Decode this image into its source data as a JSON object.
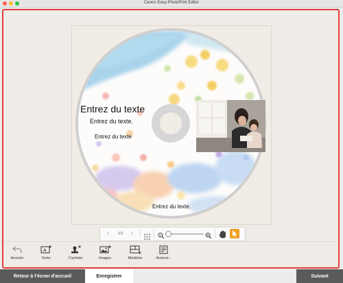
{
  "window": {
    "title": "Canon Easy-PhotoPrint Editor"
  },
  "disc": {
    "text1": "Entrez du texte",
    "text2": "Entrez du texte.",
    "text3": "Entrez du texte",
    "text4": "Entrez du texte."
  },
  "zoom_bar": {
    "page_indicator": "1/1"
  },
  "tools": {
    "undo": "Annuler",
    "text": "Texte",
    "stamps": "Cachets",
    "images": "Images",
    "templates": "Modèles",
    "advanced": "Avancé..."
  },
  "footer": {
    "back_home": "Retour à l'écran d'accueil",
    "save": "Enregistrer",
    "next": "Suivant"
  },
  "colors": {
    "accent_red": "#e53b3b",
    "dark_button": "#585858",
    "hand_active": "#f0a020"
  }
}
